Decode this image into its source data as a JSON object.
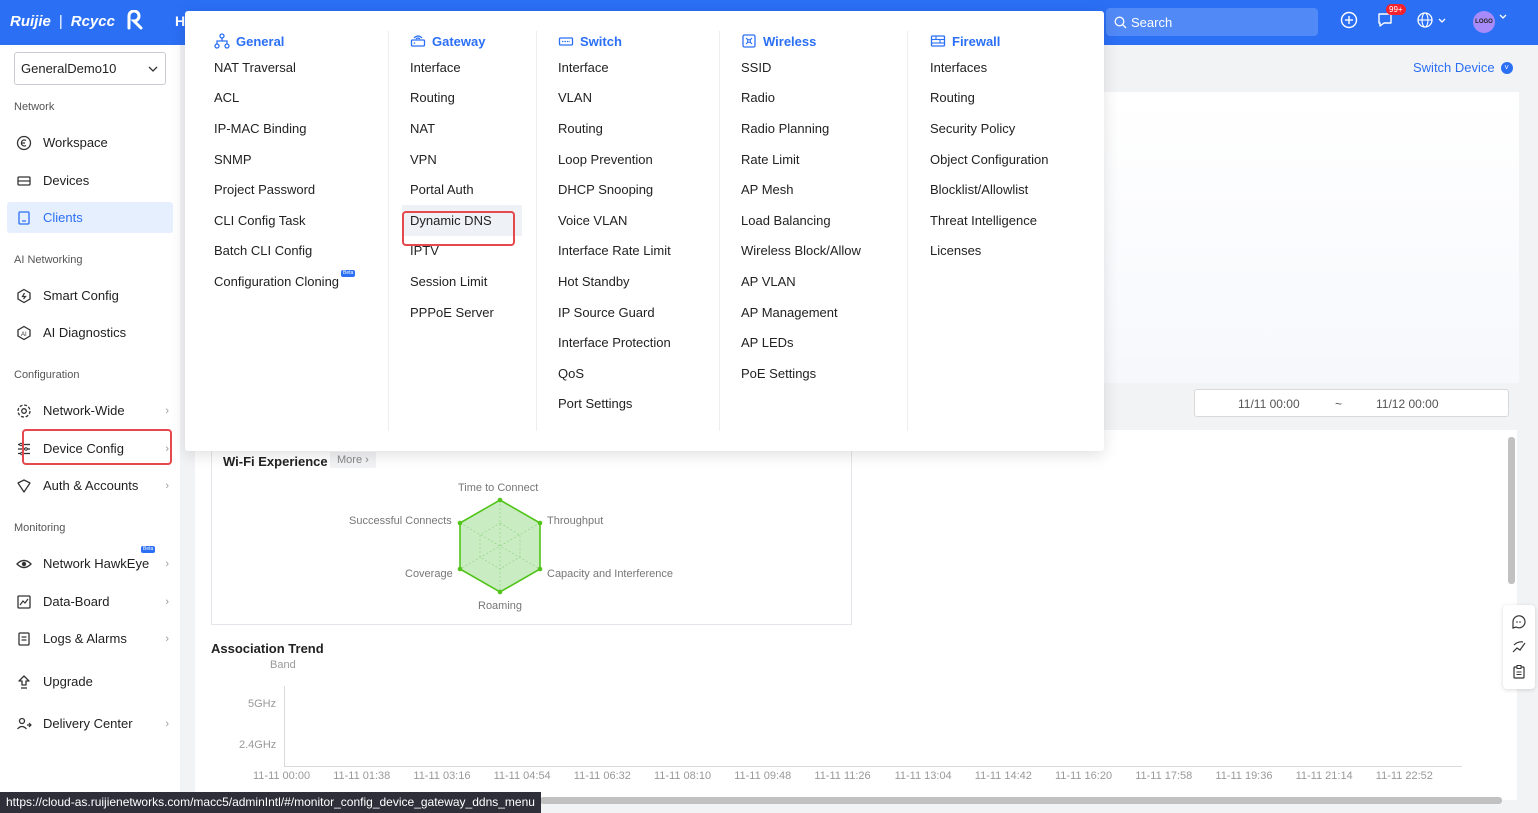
{
  "topbar": {
    "brand": "Ruijie",
    "product": "Rcycc",
    "home_initial": "H",
    "search_placeholder": "Search",
    "notification_count": "99+",
    "avatar_text": "LOGO"
  },
  "sidebar": {
    "org": "GeneralDemo10",
    "sections": {
      "network": "Network",
      "ai": "AI Networking",
      "configuration": "Configuration",
      "monitoring": "Monitoring"
    },
    "items": {
      "workspace": "Workspace",
      "devices": "Devices",
      "clients": "Clients",
      "smart_config": "Smart Config",
      "ai_diagnostics": "AI Diagnostics",
      "network_wide": "Network-Wide",
      "device_config": "Device Config",
      "auth_accounts": "Auth & Accounts",
      "network_hawkeye": "Network HawkEye",
      "data_board": "Data-Board",
      "logs_alarms": "Logs & Alarms",
      "upgrade": "Upgrade",
      "delivery_center": "Delivery Center"
    },
    "beta_label": "Beta"
  },
  "menu": {
    "general": {
      "title": "General",
      "items": [
        "NAT Traversal",
        "ACL",
        "IP-MAC Binding",
        "SNMP",
        "Project Password",
        "CLI Config Task",
        "Batch CLI Config",
        "Configuration Cloning"
      ]
    },
    "gateway": {
      "title": "Gateway",
      "items": [
        "Interface",
        "Routing",
        "NAT",
        "VPN",
        "Portal Auth",
        "Dynamic DNS",
        "IPTV",
        "Session Limit",
        "PPPoE Server"
      ]
    },
    "switch": {
      "title": "Switch",
      "items": [
        "Interface",
        "VLAN",
        "Routing",
        "Loop Prevention",
        "DHCP Snooping",
        "Voice VLAN",
        "Interface Rate Limit",
        "Hot Standby",
        "IP Source Guard",
        "Interface Protection",
        "QoS",
        "Port Settings"
      ]
    },
    "wireless": {
      "title": "Wireless",
      "items": [
        "SSID",
        "Radio",
        "Radio Planning",
        "Rate Limit",
        "AP Mesh",
        "Load Balancing",
        "Wireless Block/Allow",
        "AP VLAN",
        "AP Management",
        "AP LEDs",
        "PoE Settings"
      ]
    },
    "firewall": {
      "title": "Firewall",
      "items": [
        "Interfaces",
        "Routing",
        "Security Policy",
        "Object Configuration",
        "Blocklist/Allowlist",
        "Threat Intelligence",
        "Licenses"
      ]
    }
  },
  "main": {
    "switch_device": "Switch Device",
    "date_from": "11/11 00:00",
    "date_sep": "~",
    "date_to": "11/12 00:00",
    "wifi_title": "Wi-Fi Experience",
    "more": "More",
    "radar_labels": {
      "top": "Time to Connect",
      "top_right": "Throughput",
      "bottom_right": "Capacity and Interference",
      "bottom": "Roaming",
      "bottom_left": "Coverage",
      "top_left": "Successful Connects"
    },
    "assoc_title": "Association Trend",
    "y_axis_title": "Band",
    "y_ticks": [
      "5GHz",
      "2.4GHz"
    ],
    "x_ticks": [
      "11-11 00:00",
      "11-11 01:38",
      "11-11 03:16",
      "11-11 04:54",
      "11-11 06:32",
      "11-11 08:10",
      "11-11 09:48",
      "11-11 11:26",
      "11-11 13:04",
      "11-11 14:42",
      "11-11 16:20",
      "11-11 17:58",
      "11-11 19:36",
      "11-11 21:14",
      "11-11 22:52"
    ]
  },
  "status_url": "https://cloud-as.ruijienetworks.com/macc5/adminIntl/#/monitor_config_device_gateway_ddns_menu",
  "colors": {
    "brand_blue": "#2b6ff5",
    "highlight_red": "#e5484d",
    "radar_green": "#52c41a"
  }
}
